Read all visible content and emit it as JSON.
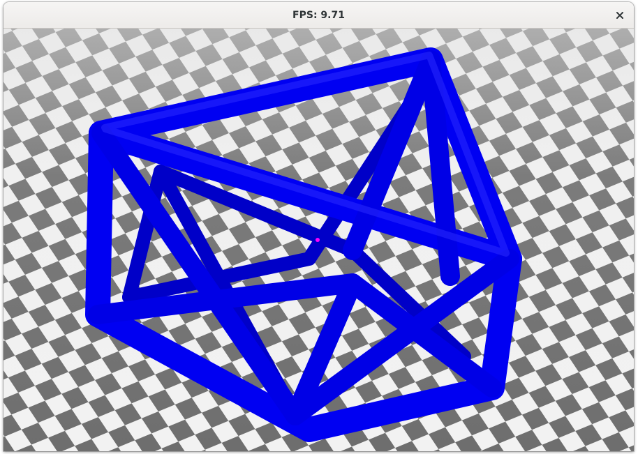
{
  "window": {
    "title": "FPS: 9.71"
  },
  "icons": {
    "close": "close-icon"
  },
  "scene": {
    "object": "wireframe-cube-mesh",
    "object_color": "#0000ff",
    "floor": "checkerboard",
    "floor_light_color": "#f2f2f2",
    "floor_dark_color": "#6e6e6e",
    "marker_color": "#ff00ff"
  }
}
